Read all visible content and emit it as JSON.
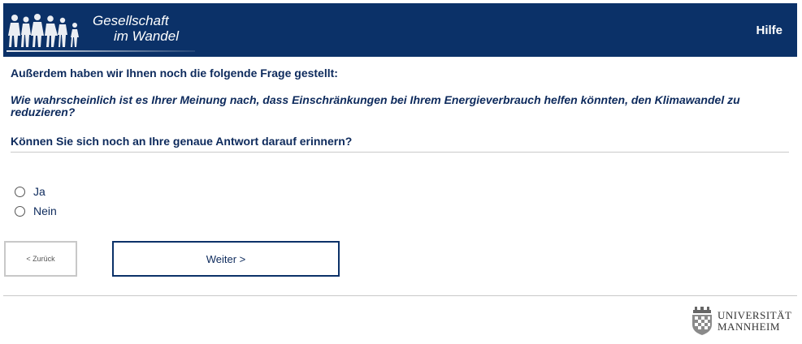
{
  "header": {
    "logo_line1": "Gesellschaft",
    "logo_line2": "im Wandel",
    "help_label": "Hilfe"
  },
  "question": {
    "intro": "Außerdem haben wir Ihnen noch die folgende Frage gestellt:",
    "text": "Wie wahrscheinlich ist es Ihrer Meinung nach, dass Einschränkungen bei Ihrem Energieverbrauch helfen könnten, den Klimawandel zu reduzieren?",
    "prompt": "Können Sie sich noch an Ihre genaue Antwort darauf erinnern?"
  },
  "options": [
    {
      "label": "Ja",
      "selected": false
    },
    {
      "label": "Nein",
      "selected": false
    }
  ],
  "navigation": {
    "back_label": "< Zurück",
    "next_label": "Weiter >"
  },
  "footer": {
    "university_line1": "UNIVERSITÄT",
    "university_line2": "MANNHEIM"
  },
  "colors": {
    "header_bg": "#0b3168",
    "text": "#0d2a5c"
  }
}
